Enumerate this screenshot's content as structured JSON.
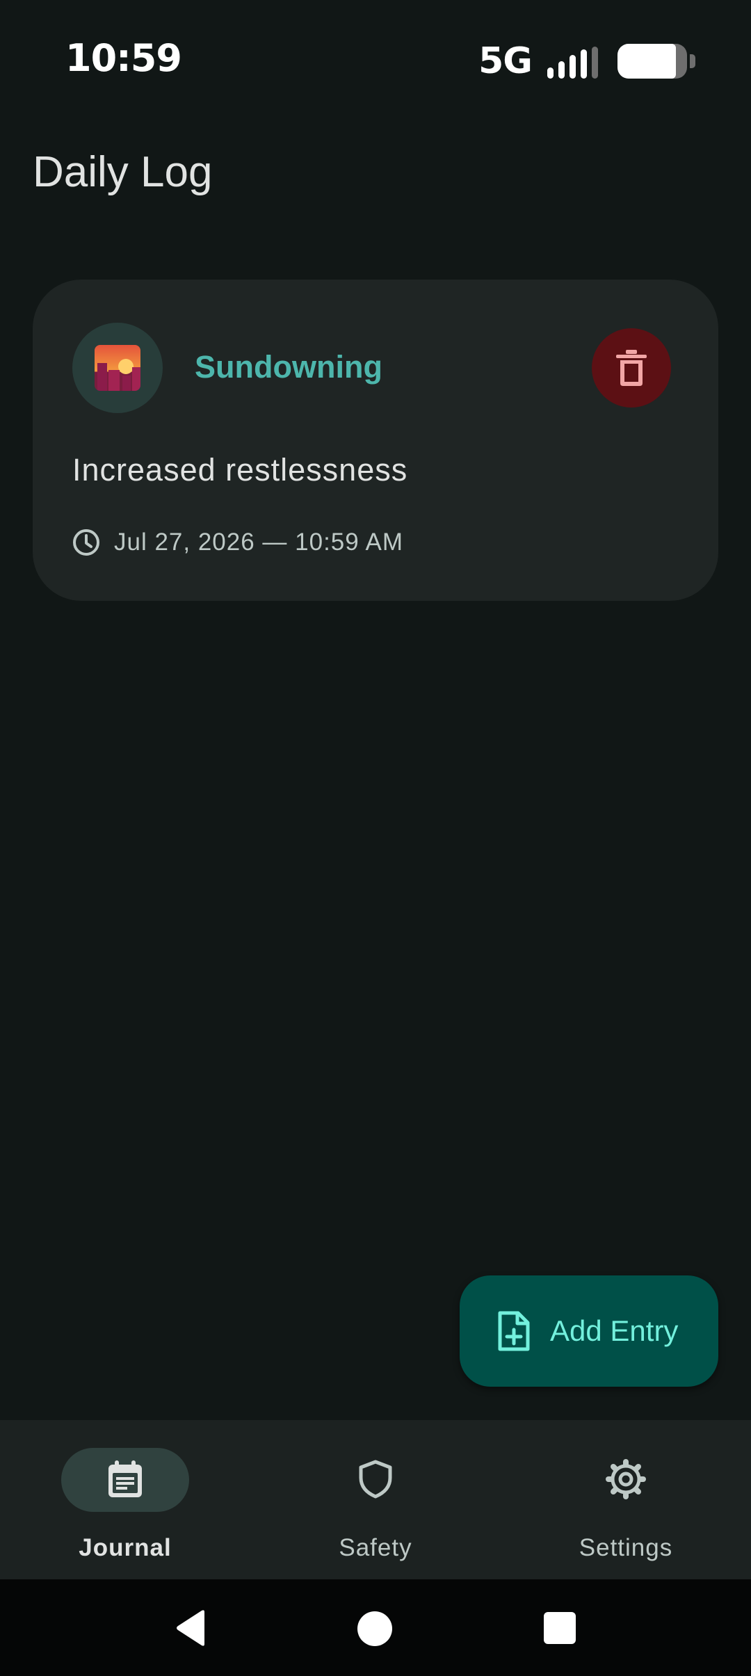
{
  "status_bar": {
    "time": "10:59",
    "network": "5G",
    "signal_bars": 4,
    "battery_level": 0.85
  },
  "header": {
    "title": "Daily Log"
  },
  "entries": [
    {
      "category": "Sundowning",
      "category_icon": "sunset-cityscape-icon",
      "text": "Increased restlessness",
      "timestamp": "Jul 27, 2026 — 10:59 AM"
    }
  ],
  "fab": {
    "label": "Add Entry",
    "icon": "note-add-icon"
  },
  "bottom_nav": {
    "items": [
      {
        "label": "Journal",
        "icon": "journal-icon",
        "active": true
      },
      {
        "label": "Safety",
        "icon": "shield-icon",
        "active": false
      },
      {
        "label": "Settings",
        "icon": "gear-icon",
        "active": false
      }
    ]
  },
  "colors": {
    "background": "#111716",
    "card": "#1f2524",
    "accent": "#4db6ac",
    "fab_background": "#005048",
    "fab_foreground": "#73f0dd",
    "delete_background": "#5c1014",
    "delete_foreground": "#f2a6a6",
    "nav_background": "#1c2221",
    "nav_indicator": "#30423f"
  }
}
